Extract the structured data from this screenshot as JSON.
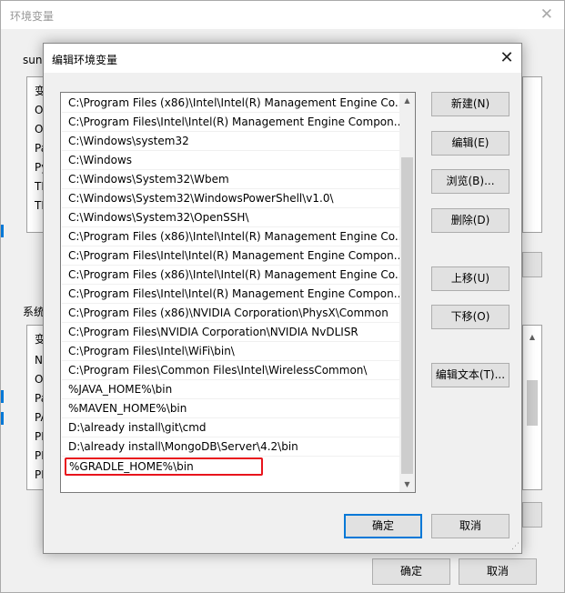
{
  "background_window": {
    "title": "环境变量",
    "user_section_label": "sunn",
    "user_list_header": "变",
    "user_rows": [
      "On",
      "On",
      "Pa",
      "Py",
      "TE",
      "TM"
    ],
    "system_section_label": "系统",
    "system_list_header": "变",
    "system_rows": [
      "NU",
      "Os",
      "Pa",
      "PA",
      "PR",
      "PR",
      "PR"
    ],
    "ok_label": "确定",
    "cancel_label": "取消"
  },
  "dialog": {
    "title": "编辑环境变量",
    "entries": [
      "C:\\Program Files (x86)\\Intel\\Intel(R) Management Engine Co...",
      "C:\\Program Files\\Intel\\Intel(R) Management Engine Compon...",
      "C:\\Windows\\system32",
      "C:\\Windows",
      "C:\\Windows\\System32\\Wbem",
      "C:\\Windows\\System32\\WindowsPowerShell\\v1.0\\",
      "C:\\Windows\\System32\\OpenSSH\\",
      "C:\\Program Files (x86)\\Intel\\Intel(R) Management Engine Co...",
      "C:\\Program Files\\Intel\\Intel(R) Management Engine Compon...",
      "C:\\Program Files (x86)\\Intel\\Intel(R) Management Engine Co...",
      "C:\\Program Files\\Intel\\Intel(R) Management Engine Compon...",
      "C:\\Program Files (x86)\\NVIDIA Corporation\\PhysX\\Common",
      "C:\\Program Files\\NVIDIA Corporation\\NVIDIA NvDLISR",
      "C:\\Program Files\\Intel\\WiFi\\bin\\",
      "C:\\Program Files\\Common Files\\Intel\\WirelessCommon\\",
      "%JAVA_HOME%\\bin",
      "%MAVEN_HOME%\\bin",
      "D:\\already install\\git\\cmd",
      "D:\\already install\\MongoDB\\Server\\4.2\\bin"
    ],
    "editing_entry": "%GRADLE_HOME%\\bin",
    "buttons": {
      "new": "新建(N)",
      "edit": "编辑(E)",
      "browse": "浏览(B)...",
      "delete": "删除(D)",
      "move_up": "上移(U)",
      "move_down": "下移(O)",
      "edit_text": "编辑文本(T)..."
    },
    "ok_label": "确定",
    "cancel_label": "取消"
  }
}
